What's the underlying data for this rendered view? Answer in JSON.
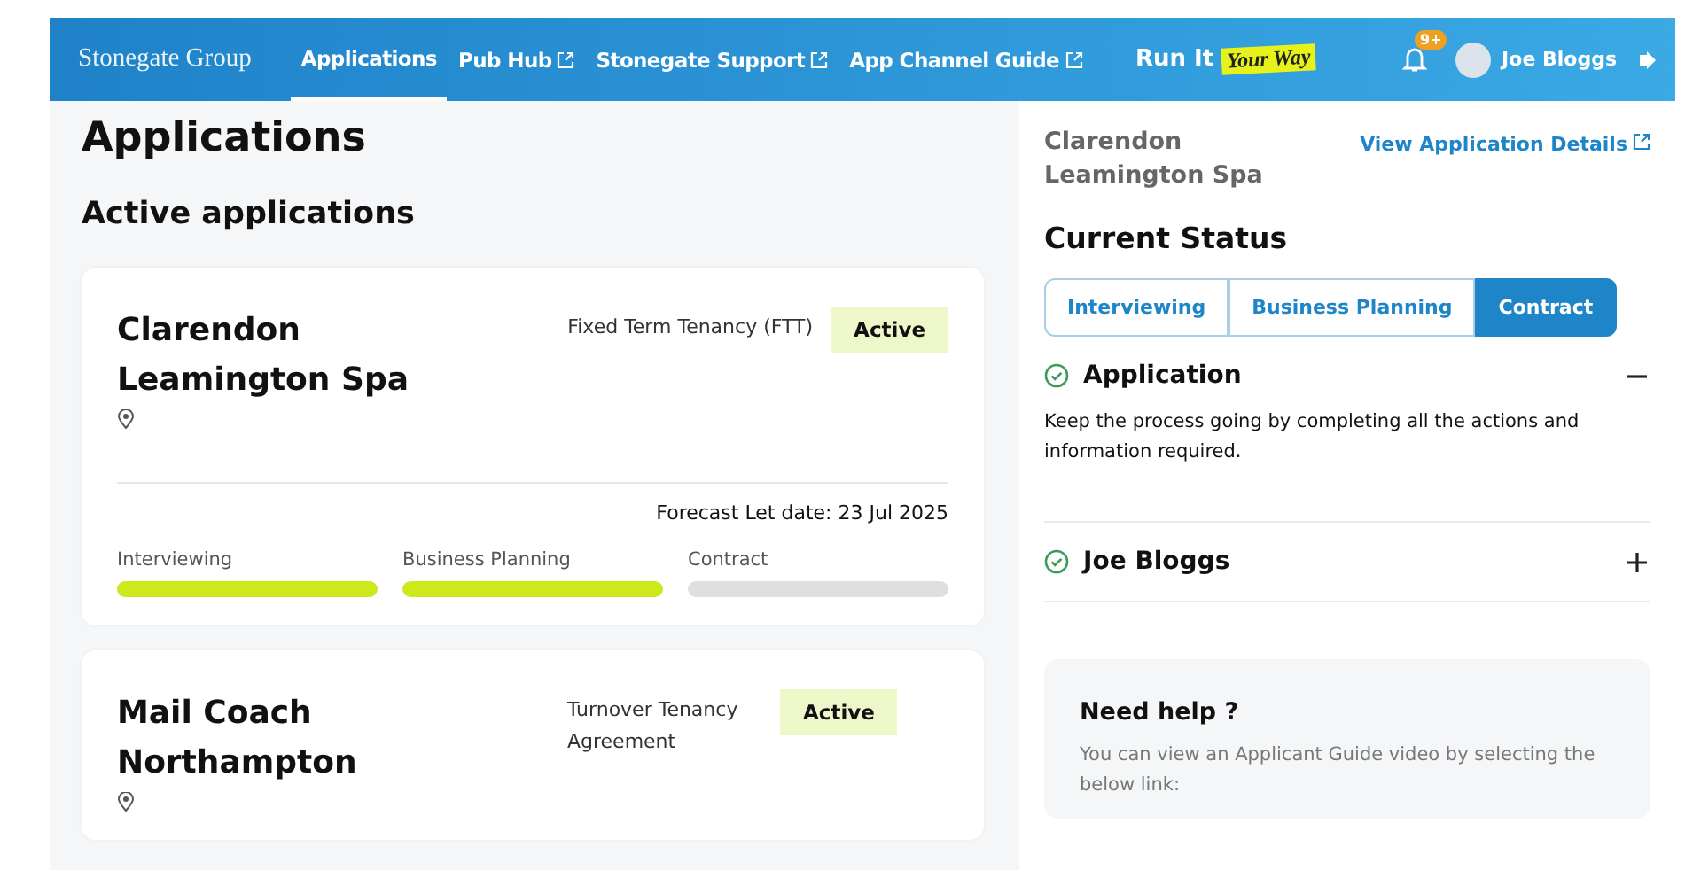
{
  "header": {
    "brand": "Stonegate Group",
    "nav": [
      {
        "label": "Applications",
        "selected": true,
        "external": false
      },
      {
        "label": "Pub Hub",
        "selected": false,
        "external": true
      },
      {
        "label": "Stonegate Support",
        "selected": false,
        "external": true
      },
      {
        "label": "App Channel Guide",
        "selected": false,
        "external": true
      }
    ],
    "slogan": {
      "text": "Run It",
      "highlight": "Your Way"
    },
    "notification_badge": "9+",
    "user": "Joe Bloggs"
  },
  "page_title": "Applications",
  "section_title": "Active applications",
  "applications": [
    {
      "name": "Clarendon Leamington Spa",
      "tenancy": "Fixed Term Tenancy (FTT)",
      "status": "Active",
      "forecast": "Forecast Let date: 23 Jul 2025",
      "stages": [
        {
          "label": "Interviewing",
          "level": 1
        },
        {
          "label": "Business Planning",
          "level": 1
        },
        {
          "label": "Contract",
          "level": 0
        }
      ]
    },
    {
      "name": "Mail Coach Northampton",
      "tenancy": "Turnover Tenancy Agreement",
      "status": "Active"
    }
  ],
  "detail": {
    "name": "Clarendon Leamington Spa",
    "link": "View Application Details",
    "status_title": "Current Status",
    "tabs": [
      {
        "label": "Interviewing",
        "selected": false
      },
      {
        "label": "Business Planning",
        "selected": false
      },
      {
        "label": "Contract",
        "selected": true
      }
    ],
    "sections": [
      {
        "title": "Application",
        "expanded": true,
        "body": "Keep the process going by completing all the actions and information required."
      },
      {
        "title": "Joe Bloggs",
        "expanded": false
      }
    ],
    "help": {
      "title": "Need help ?",
      "text": "You can view an Applicant Guide video by selecting the below link:"
    }
  }
}
